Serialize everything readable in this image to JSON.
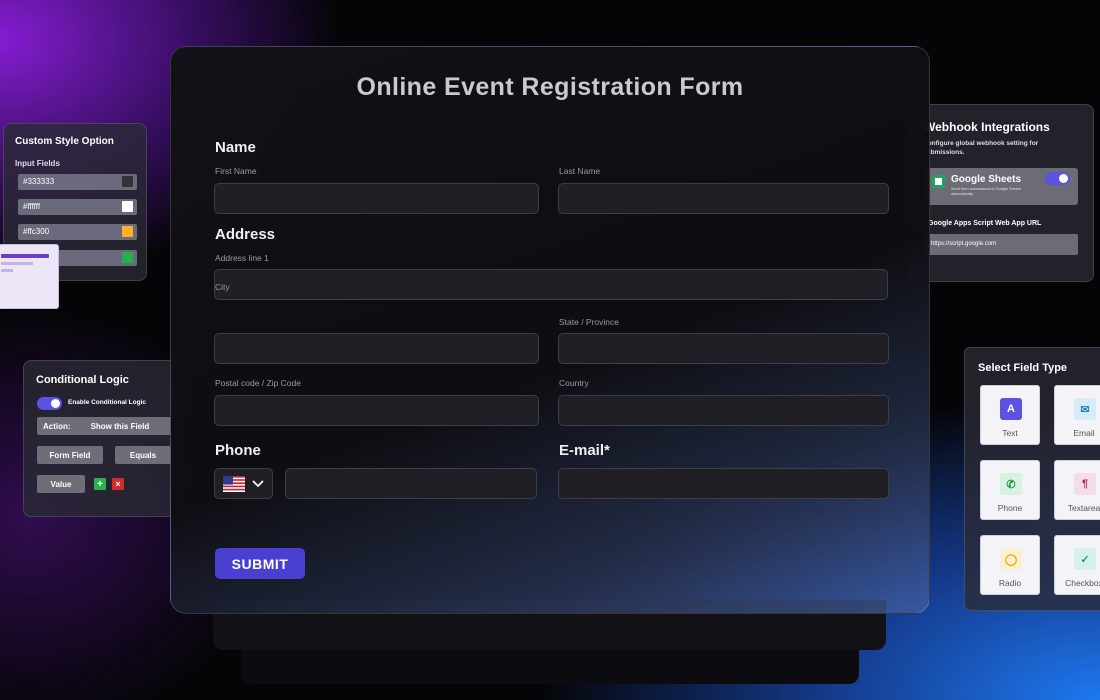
{
  "form": {
    "title": "Online Event Registration Form",
    "name_heading": "Name",
    "first_name_label": "First Name",
    "last_name_label": "Last Name",
    "address_heading": "Address",
    "address_line1_label": "Address line 1",
    "city_label": "City",
    "state_label": "State / Province",
    "postal_label": "Postal code / Zip Code",
    "country_label": "Country",
    "phone_heading": "Phone",
    "email_heading": "E-mail*",
    "submit_label": "SUBMIT"
  },
  "custom_style": {
    "title": "Custom Style Option",
    "subtitle": "Input Fields",
    "rows": [
      {
        "label": "#333333",
        "color": "#333333"
      },
      {
        "label": "#ffffff",
        "color": "#ffffff"
      },
      {
        "label": "#ffc300",
        "color": "#ffb020"
      },
      {
        "label": "",
        "color": "#22b14c"
      }
    ]
  },
  "webhook": {
    "title": "Webhook Integrations",
    "description": "Configure global webhook setting for submissions.",
    "service_name": "Google Sheets",
    "service_desc": "Send form submissions to Google Sheets automatically",
    "url_label": "Google Apps Script Web App URL",
    "url_value": "https://script.google.com"
  },
  "conditional": {
    "title": "Conditional Logic",
    "toggle_label": "Enable Conditional Logic",
    "action_label": "Action:",
    "action_value": "Show this Field",
    "form_field_label": "Form Field",
    "equals_label": "Equals",
    "value_label": "Value",
    "add_symbol": "+",
    "remove_symbol": "×"
  },
  "field_types": {
    "title": "Select Field Type",
    "items": [
      {
        "label": "Text",
        "icon": "A",
        "icon_name": "text-icon"
      },
      {
        "label": "Email",
        "icon": "✉",
        "icon_name": "email-icon"
      },
      {
        "label": "Phone",
        "icon": "✆",
        "icon_name": "phone-icon"
      },
      {
        "label": "Textarea",
        "icon": "¶",
        "icon_name": "textarea-icon"
      },
      {
        "label": "Radio",
        "icon": "◯",
        "icon_name": "radio-icon"
      },
      {
        "label": "Checkbox",
        "icon": "✓",
        "icon_name": "checkbox-icon"
      }
    ]
  }
}
